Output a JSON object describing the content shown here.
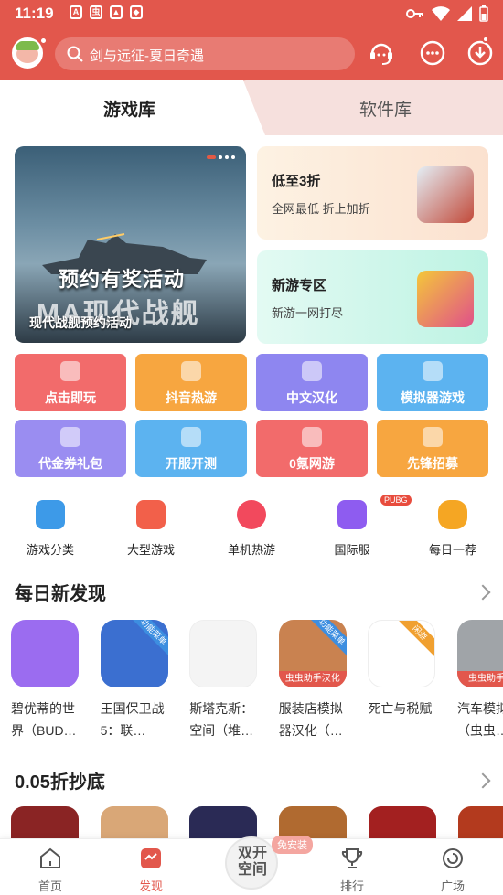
{
  "status": {
    "time": "11:19"
  },
  "search": {
    "placeholder": "剑与远征-夏日奇遇"
  },
  "tabs": [
    {
      "label": "游戏库"
    },
    {
      "label": "软件库"
    }
  ],
  "banner": {
    "promo": "预约有奖活动",
    "logo": "MA现代战舰",
    "caption": "现代战舰预约活动"
  },
  "promos": [
    {
      "title": "低至3折",
      "subtitle": "全网最低 折上加折"
    },
    {
      "title": "新游专区",
      "subtitle": "新游一网打尽"
    }
  ],
  "categories": [
    {
      "label": "点击即玩",
      "color": "#f26b6b"
    },
    {
      "label": "抖音热游",
      "color": "#f7a640"
    },
    {
      "label": "中文汉化",
      "color": "#8e86f0"
    },
    {
      "label": "模拟器游戏",
      "color": "#5cb3f0"
    },
    {
      "label": "代金券礼包",
      "color": "#9a8df1"
    },
    {
      "label": "开服开测",
      "color": "#5cb3f0"
    },
    {
      "label": "0氪网游",
      "color": "#f26b6b"
    },
    {
      "label": "先锋招募",
      "color": "#f7a640"
    }
  ],
  "quick": [
    {
      "label": "游戏分类",
      "icon": "category-icon"
    },
    {
      "label": "大型游戏",
      "icon": "large-game-icon"
    },
    {
      "label": "单机热游",
      "icon": "offline-game-icon"
    },
    {
      "label": "国际服",
      "icon": "planet-icon",
      "badge": "PUBG"
    },
    {
      "label": "每日一荐",
      "icon": "daily-star-icon"
    }
  ],
  "daily": {
    "title": "每日新发现",
    "games": [
      {
        "name": "碧优蒂的世界（BUD…",
        "color": "#9b6cf0"
      },
      {
        "name": "王国保卫战5：联…",
        "color": "#3b6fd0",
        "tag": "功能菜单"
      },
      {
        "name": "斯塔克斯：空间（堆…",
        "color": "#f4f4f4"
      },
      {
        "name": "服装店模拟器汉化（…",
        "color": "#c98250",
        "tag": "功能菜单",
        "bottom": "虫虫助手汉化"
      },
      {
        "name": "死亡与税赋",
        "color": "#ffffff",
        "tag": "闲游"
      },
      {
        "name": "汽车模拟化（虫虫…",
        "color": "#a0a4a8",
        "bottom": "虫虫助手汉"
      }
    ]
  },
  "discount": {
    "title": "0.05折抄底"
  },
  "nav": [
    {
      "label": "首页"
    },
    {
      "label": "发现"
    },
    {
      "label": "双开空间",
      "badge": "免安装"
    },
    {
      "label": "排行"
    },
    {
      "label": "广场"
    }
  ],
  "colors": {
    "brand": "#e2574c"
  }
}
